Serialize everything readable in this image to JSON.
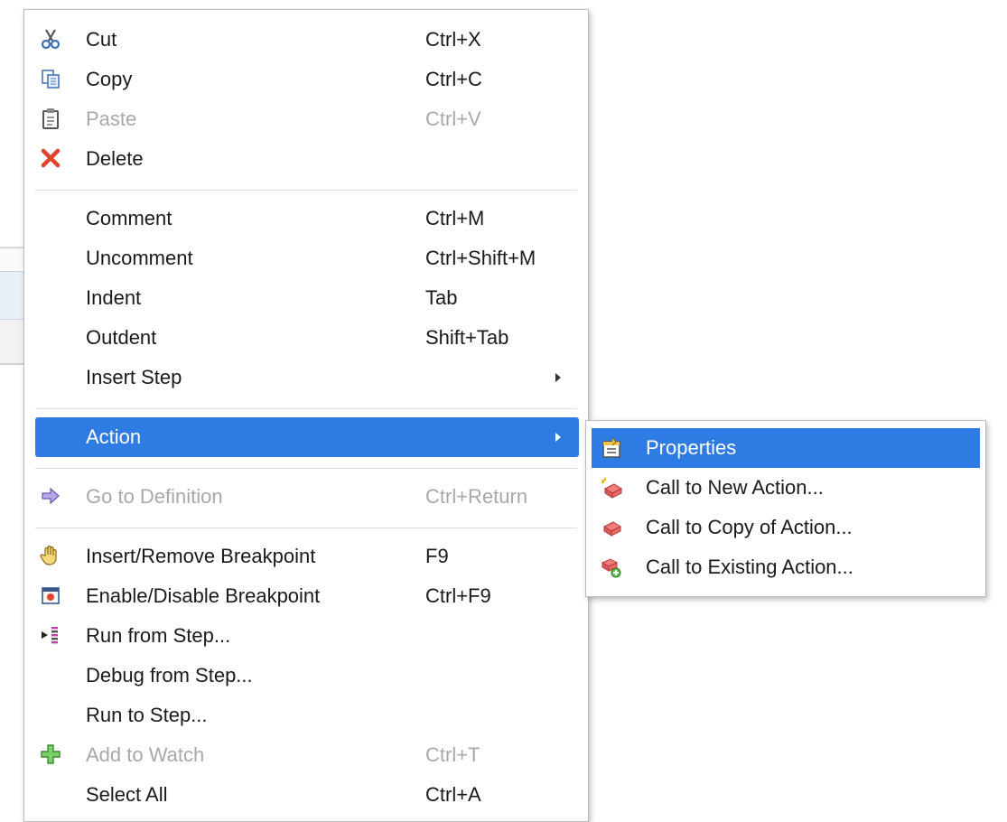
{
  "menu": {
    "items": [
      {
        "label": "Cut",
        "shortcut": "Ctrl+X",
        "icon": "scissors-icon"
      },
      {
        "label": "Copy",
        "shortcut": "Ctrl+C",
        "icon": "copy-icon"
      },
      {
        "label": "Paste",
        "shortcut": "Ctrl+V",
        "icon": "clipboard-icon",
        "disabled": true
      },
      {
        "label": "Delete",
        "shortcut": "",
        "icon": "delete-x-icon"
      },
      {
        "label": "Comment",
        "shortcut": "Ctrl+M"
      },
      {
        "label": "Uncomment",
        "shortcut": "Ctrl+Shift+M"
      },
      {
        "label": "Indent",
        "shortcut": "Tab"
      },
      {
        "label": "Outdent",
        "shortcut": "Shift+Tab"
      },
      {
        "label": "Insert Step",
        "shortcut": "",
        "submenu": true
      },
      {
        "label": "Action",
        "shortcut": "",
        "submenu": true,
        "selected": true
      },
      {
        "label": "Go to Definition",
        "shortcut": "Ctrl+Return",
        "icon": "arrow-right-icon",
        "disabled": true
      },
      {
        "label": "Insert/Remove Breakpoint",
        "shortcut": "F9",
        "icon": "hand-icon"
      },
      {
        "label": "Enable/Disable Breakpoint",
        "shortcut": "Ctrl+F9",
        "icon": "breakpoint-icon"
      },
      {
        "label": "Run from Step...",
        "shortcut": "",
        "icon": "run-from-step-icon"
      },
      {
        "label": "Debug from Step...",
        "shortcut": ""
      },
      {
        "label": "Run to Step...",
        "shortcut": ""
      },
      {
        "label": "Add to Watch",
        "shortcut": "Ctrl+T",
        "icon": "plus-icon",
        "disabled": true
      },
      {
        "label": "Select All",
        "shortcut": "Ctrl+A"
      }
    ]
  },
  "submenu": {
    "items": [
      {
        "label": "Properties",
        "icon": "properties-icon",
        "selected": true
      },
      {
        "label": "Call to New Action...",
        "icon": "new-action-icon"
      },
      {
        "label": "Call to Copy of Action...",
        "icon": "copy-action-icon"
      },
      {
        "label": "Call to Existing Action...",
        "icon": "existing-action-icon"
      }
    ]
  },
  "colors": {
    "highlight": "#2e7ce3",
    "disabled_text": "#a8a8a8"
  }
}
